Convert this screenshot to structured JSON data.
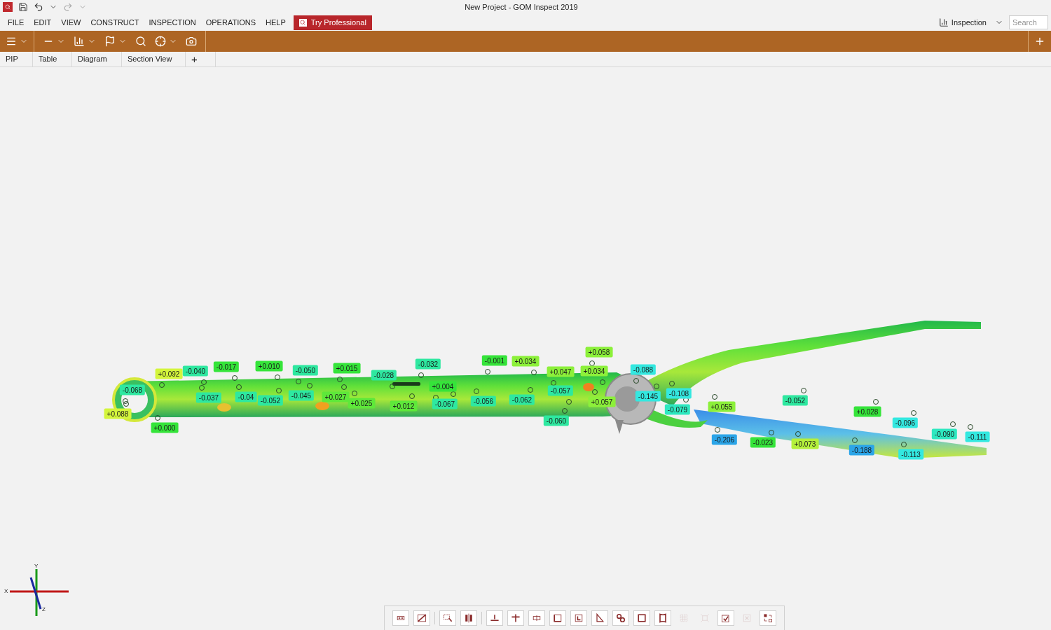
{
  "window": {
    "title": "New Project - GOM Inspect 2019"
  },
  "menu": [
    "FILE",
    "EDIT",
    "VIEW",
    "CONSTRUCT",
    "INSPECTION",
    "OPERATIONS",
    "HELP"
  ],
  "promo_button": "Try Professional",
  "workspace": {
    "label": "Inspection"
  },
  "search": {
    "placeholder": "Search"
  },
  "tabs": [
    "PIP",
    "Table",
    "Diagram",
    "Section View",
    "+"
  ],
  "labels": [
    {
      "text": "+0.092",
      "color": "#d4f53c"
    },
    {
      "text": "-0.040",
      "color": "#2ee8a0"
    },
    {
      "text": "-0.068",
      "color": "#2ee8a0"
    },
    {
      "text": "+0.088",
      "color": "#d4f53c"
    },
    {
      "text": "+0.000",
      "color": "#35e43a"
    },
    {
      "text": "-0.017",
      "color": "#35e43a"
    },
    {
      "text": "-0.037",
      "color": "#2ee8a0"
    },
    {
      "text": "+0.010",
      "color": "#35e43a"
    },
    {
      "text": "-0.04",
      "color": "#2ee8a0"
    },
    {
      "text": "-0.052",
      "color": "#2ee8a0"
    },
    {
      "text": "-0.050",
      "color": "#2ee8a0"
    },
    {
      "text": "-0.045",
      "color": "#2ee8a0"
    },
    {
      "text": "+0.015",
      "color": "#35e43a"
    },
    {
      "text": "+0.027",
      "color": "#5ee83a"
    },
    {
      "text": "+0.025",
      "color": "#5ee83a"
    },
    {
      "text": "-0.028",
      "color": "#2ee8a0"
    },
    {
      "text": "-0.032",
      "color": "#2ee8a0"
    },
    {
      "text": "+0.012",
      "color": "#5ee83a"
    },
    {
      "text": "+0.004",
      "color": "#35e43a"
    },
    {
      "text": "-0.067",
      "color": "#2ee8a0"
    },
    {
      "text": "-0.001",
      "color": "#35e43a"
    },
    {
      "text": "+0.034",
      "color": "#8cf03a"
    },
    {
      "text": "-0.056",
      "color": "#2ee8a0"
    },
    {
      "text": "-0.062",
      "color": "#2ee8a0"
    },
    {
      "text": "+0.047",
      "color": "#8cf03a"
    },
    {
      "text": "+0.034",
      "color": "#8cf03a"
    },
    {
      "text": "+0.058",
      "color": "#8cf03a"
    },
    {
      "text": "-0.057",
      "color": "#2ee8a0"
    },
    {
      "text": "+0.057",
      "color": "#8cf03a"
    },
    {
      "text": "-0.060",
      "color": "#2ee8a0"
    },
    {
      "text": "-0.088",
      "color": "#33e8e0"
    },
    {
      "text": "-0.145",
      "color": "#33e8e0"
    },
    {
      "text": "-0.108",
      "color": "#33e8e0"
    },
    {
      "text": "-0.079",
      "color": "#2ee8c0"
    },
    {
      "text": "+0.055",
      "color": "#8cf03a"
    },
    {
      "text": "-0.052",
      "color": "#2ee8a0"
    },
    {
      "text": "-0.206",
      "color": "#2ba5e8"
    },
    {
      "text": "-0.023",
      "color": "#35e43a"
    },
    {
      "text": "+0.073",
      "color": "#b4f03c"
    },
    {
      "text": "+0.028",
      "color": "#35e43a"
    },
    {
      "text": "-0.188",
      "color": "#2ba5e8"
    },
    {
      "text": "-0.096",
      "color": "#33e8e0"
    },
    {
      "text": "-0.113",
      "color": "#33e8e0"
    },
    {
      "text": "-0.090",
      "color": "#2ee8c0"
    },
    {
      "text": "-0.111",
      "color": "#33e8e0"
    }
  ],
  "axis": {
    "x": "X",
    "y": "Y",
    "z": "Z"
  },
  "bottom_toolbar": [
    {
      "disabled": false
    },
    {
      "disabled": false
    },
    {
      "disabled": false
    },
    {
      "disabled": false
    },
    {
      "disabled": false
    },
    {
      "disabled": false
    },
    {
      "disabled": false
    },
    {
      "disabled": false
    },
    {
      "disabled": false
    },
    {
      "disabled": false
    },
    {
      "disabled": false
    },
    {
      "disabled": false
    },
    {
      "disabled": false
    },
    {
      "disabled": true
    },
    {
      "disabled": true
    },
    {
      "disabled": false
    },
    {
      "disabled": true
    },
    {
      "disabled": false
    }
  ]
}
